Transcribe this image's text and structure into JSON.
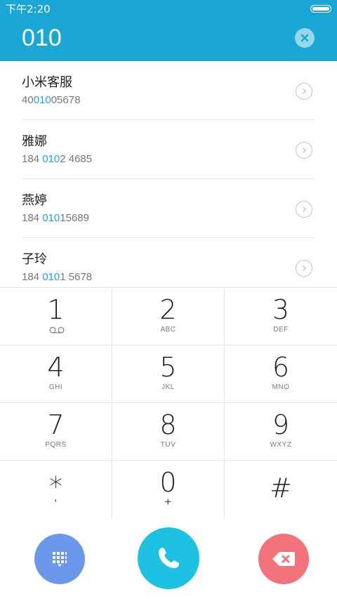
{
  "status_bar": {
    "time": "下午2:20"
  },
  "header": {
    "dialed_number": "010",
    "clear_icon": "close-circle-icon"
  },
  "results": [
    {
      "name": "小米客服",
      "phone_parts": [
        "40",
        "010",
        "05678"
      ]
    },
    {
      "name": "雅娜",
      "phone_parts": [
        "184 ",
        "010",
        "2 4685"
      ]
    },
    {
      "name": "燕婷",
      "phone_parts": [
        "184 ",
        "010",
        "15689"
      ]
    },
    {
      "name": "子玲",
      "phone_parts": [
        "184 ",
        "010",
        "1 5678"
      ]
    }
  ],
  "keypad": {
    "keys": [
      {
        "digit": "1",
        "letters": ""
      },
      {
        "digit": "2",
        "letters": "ABC"
      },
      {
        "digit": "3",
        "letters": "DEF"
      },
      {
        "digit": "4",
        "letters": "GHI"
      },
      {
        "digit": "5",
        "letters": "JKL"
      },
      {
        "digit": "6",
        "letters": "MNO"
      },
      {
        "digit": "7",
        "letters": "PQRS"
      },
      {
        "digit": "8",
        "letters": "TUV"
      },
      {
        "digit": "9",
        "letters": "WXYZ"
      },
      {
        "digit": "*",
        "letters": ","
      },
      {
        "digit": "0",
        "letters": "+"
      },
      {
        "digit": "#",
        "letters": ""
      }
    ]
  },
  "actions": {
    "keypad_icon": "dialpad-icon",
    "call_icon": "phone-icon",
    "backspace_icon": "backspace-icon"
  },
  "colors": {
    "header": "#1aa7d6",
    "highlight": "#1aa7d6",
    "keypad_button": "#6b98ea",
    "call_button": "#1fc1e3",
    "backspace_button": "#f3737a"
  }
}
